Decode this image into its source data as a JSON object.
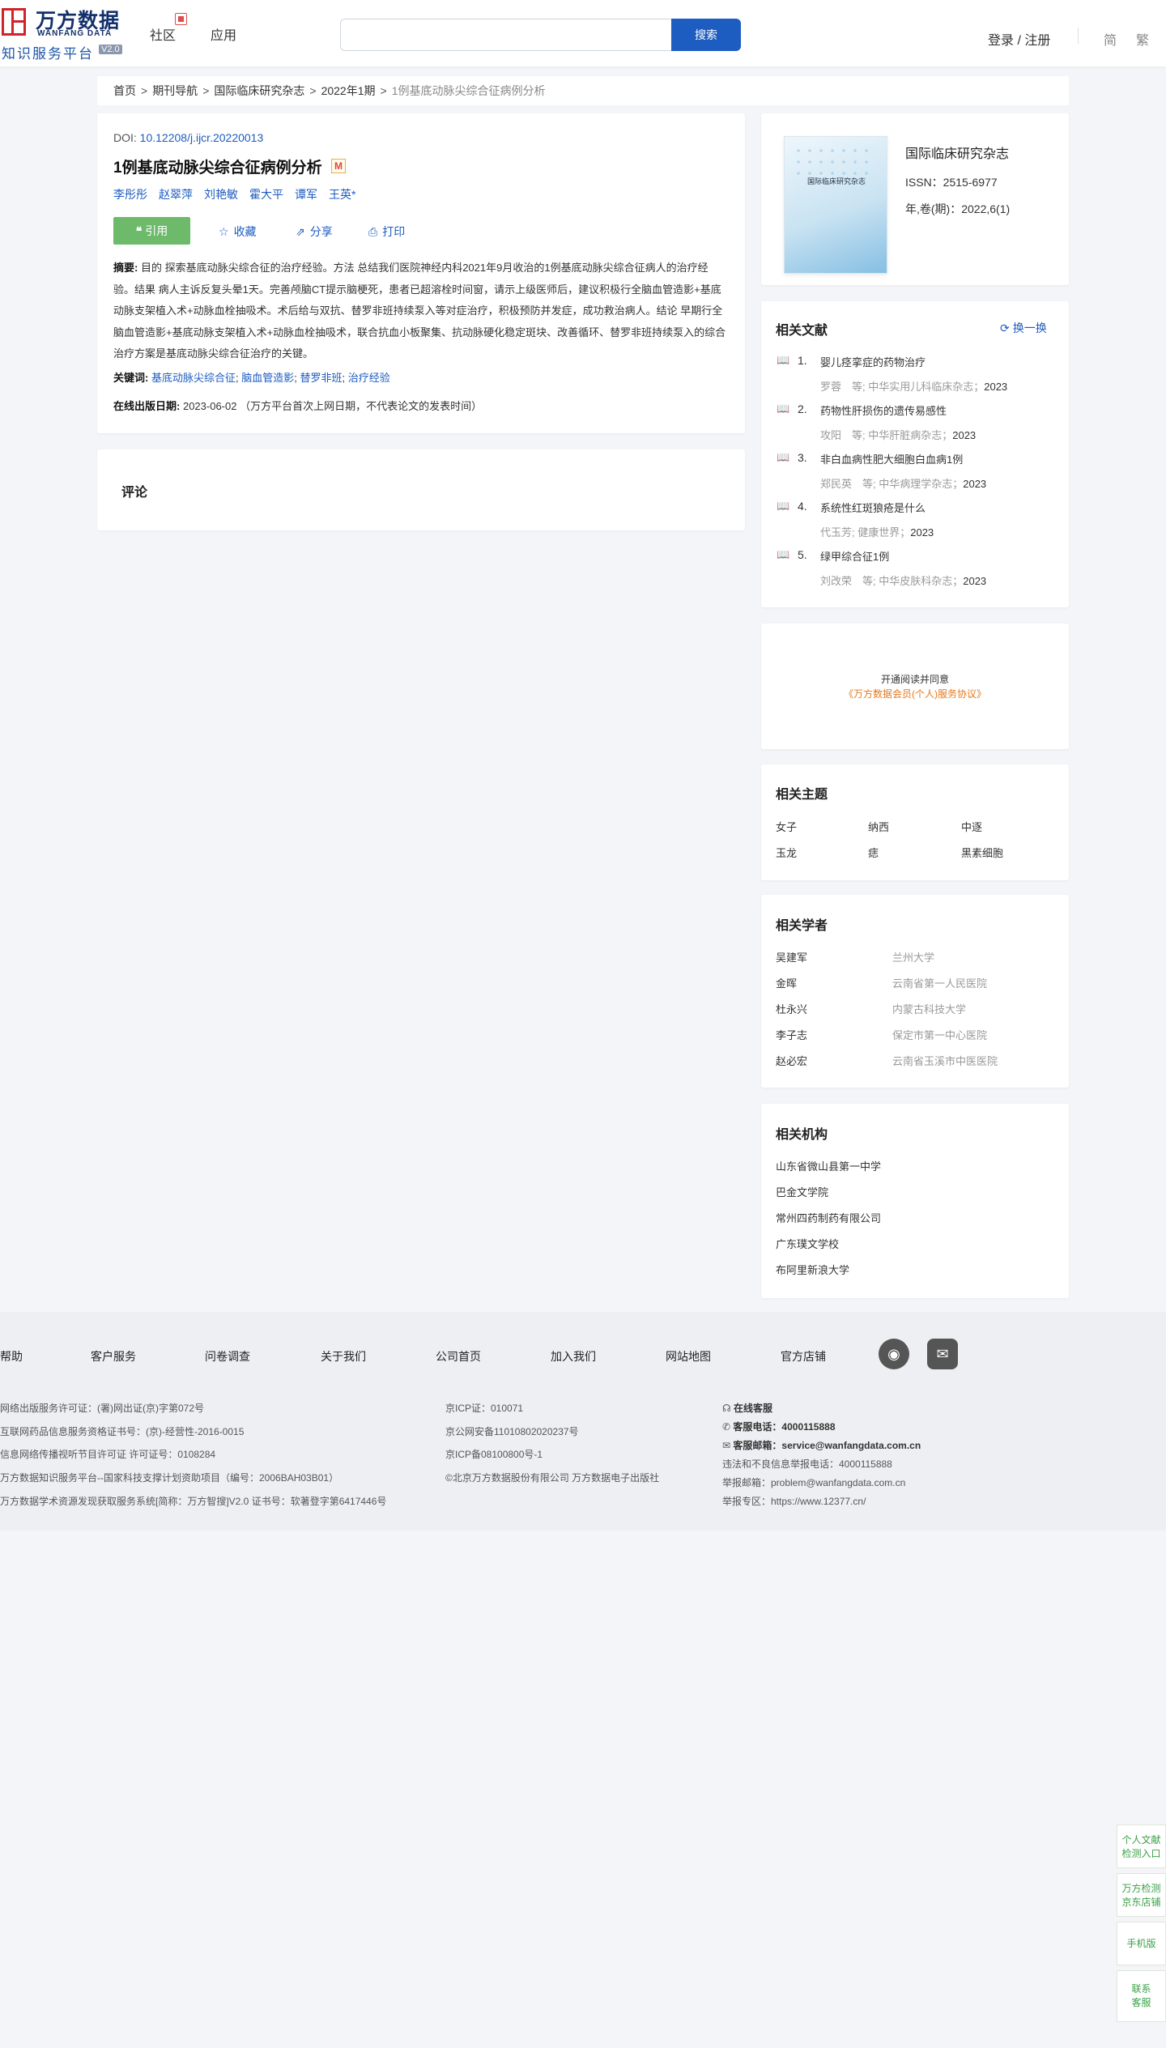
{
  "header": {
    "logo": {
      "cn": "万方数据",
      "en": "WANFANG DATA",
      "sub": "知识服务平台",
      "version": "V2.0"
    },
    "nav": {
      "community": "社区",
      "apps": "应用"
    },
    "search": {
      "placeholder": "",
      "button": "搜索"
    },
    "login": "登录 / 注册",
    "lang_simplified": "简",
    "lang_traditional": "繁"
  },
  "breadcrumb": {
    "home": "首页",
    "journals": "期刊导航",
    "journal": "国际临床研究杂志",
    "issue": "2022年1期",
    "current": "1例基底动脉尖综合征病例分析",
    "sep": ">"
  },
  "article": {
    "doi_label": "DOI:",
    "doi": "10.12208/j.ijcr.20220013",
    "title": "1例基底动脉尖综合征病例分析",
    "badge": "M",
    "authors": [
      "李彤彤",
      "赵翠萍",
      "刘艳敏",
      "霍大平",
      "谭军",
      "王英*"
    ],
    "actions": {
      "cite": "引用",
      "favorite": "收藏",
      "share": "分享",
      "print": "打印"
    },
    "abstract_label": "摘要:",
    "abstract": "目的 探索基底动脉尖综合征的治疗经验。方法 总结我们医院神经内科2021年9月收治的1例基底动脉尖综合征病人的治疗经验。结果 病人主诉反复头晕1天。完善颅脑CT提示脑梗死，患者已超溶栓时间窗，请示上级医师后，建议积极行全脑血管造影+基底动脉支架植入术+动脉血栓抽吸术。术后给与双抗、替罗非班持续泵入等对症治疗，积极预防并发症，成功救治病人。结论 早期行全脑血管造影+基底动脉支架植入术+动脉血栓抽吸术，联合抗血小板聚集、抗动脉硬化稳定斑块、改善循环、替罗非班持续泵入的综合治疗方案是基底动脉尖综合征治疗的关键。",
    "keywords_label": "关键词:",
    "keywords": [
      "基底动脉尖综合征",
      "脑血管造影",
      "替罗非班",
      "治疗经验"
    ],
    "online_label": "在线出版日期:",
    "online_date": "2023-06-02",
    "online_note": "（万方平台首次上网日期，不代表论文的发表时间）",
    "comment_title": "评论"
  },
  "journal_info": {
    "cover_title": "国际临床研究杂志",
    "name": "国际临床研究杂志",
    "issn": "ISSN：2515-6977",
    "year": "年,卷(期)：2022,6(1)"
  },
  "related_docs": {
    "title": "相关文献",
    "refresh": "换一换",
    "items": [
      {
        "num": "1.",
        "title": "婴儿痉挛症的药物治疗",
        "meta": "罗蓉　等;  中华实用儿科临床杂志；",
        "year": "2023"
      },
      {
        "num": "2.",
        "title": "药物性肝损伤的遗传易感性",
        "meta": "攻阳　等;  中华肝脏病杂志；",
        "year": "2023"
      },
      {
        "num": "3.",
        "title": "非白血病性肥大细胞白血病1例",
        "meta": "郑民英　等;  中华病理学杂志；",
        "year": "2023"
      },
      {
        "num": "4.",
        "title": "系统性红斑狼疮是什么",
        "meta": "代玉芳;  健康世界；",
        "year": "2023"
      },
      {
        "num": "5.",
        "title": "绿甲综合征1例",
        "meta": "刘改荣　等;  中华皮肤科杂志；",
        "year": "2023"
      }
    ]
  },
  "promo": {
    "line1": "开通阅读并同意",
    "line2": "《万方数据会员(个人)服务协议》"
  },
  "related_topics": {
    "title": "相关主题",
    "items": [
      "女子",
      "纳西",
      "中逐",
      "玉龙",
      "痣",
      "黑素细胞"
    ]
  },
  "related_scholars": {
    "title": "相关学者",
    "items": [
      {
        "name": "吴建军",
        "org": "兰州大学"
      },
      {
        "name": "金晖",
        "org": "云南省第一人民医院"
      },
      {
        "name": "杜永兴",
        "org": "内蒙古科技大学"
      },
      {
        "name": "李子志",
        "org": "保定市第一中心医院"
      },
      {
        "name": "赵必宏",
        "org": "云南省玉溪市中医医院"
      }
    ]
  },
  "related_institutions": {
    "title": "相关机构",
    "items": [
      "山东省微山县第一中学",
      "巴金文学院",
      "常州四药制药有限公司",
      "广东璞文学校",
      "布阿里新浪大学"
    ]
  },
  "footer": {
    "links": [
      "帮助",
      "客户服务",
      "问卷调查",
      "关于我们",
      "公司首页",
      "加入我们",
      "网站地图",
      "官方店铺"
    ],
    "col1": [
      "网络出版服务许可证：(署)网出证(京)字第072号",
      "互联网药品信息服务资格证书号：(京)-经营性-2016-0015",
      "信息网络传播视听节目许可证 许可证号：0108284",
      "万方数据知识服务平台--国家科技支撑计划资助项目（编号：2006BAH03B01）",
      "万方数据学术资源发现获取服务系统[简称：万方智搜]V2.0 证书号：软著登字第6417446号"
    ],
    "col2": [
      "京ICP证：010071",
      "京公网安备11010802020237号",
      "京ICP备08100800号-1",
      "©北京万方数据股份有限公司 万方数据电子出版社"
    ],
    "col3": {
      "online": "在线客服",
      "phone_label": "客服电话：",
      "phone": "4000115888",
      "email_label": "客服邮箱：",
      "email": "service@wanfangdata.com.cn",
      "report_phone": "违法和不良信息举报电话：4000115888",
      "report_email": "举报邮箱：problem@wanfangdata.com.cn",
      "report_zone": "举报专区：https://www.12377.cn/"
    }
  },
  "side_float": {
    "entry1_a": "个人文献",
    "entry1_b": "检测入口",
    "entry2_a": "万方检测",
    "entry2_b": "京东店铺",
    "entry3": "手机版",
    "entry4_a": "联系",
    "entry4_b": "客服"
  }
}
